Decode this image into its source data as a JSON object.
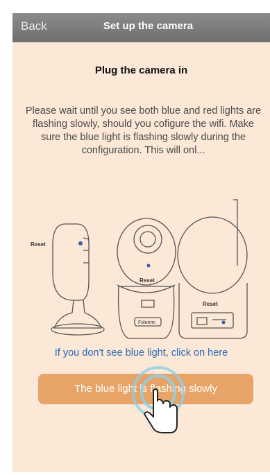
{
  "navbar": {
    "back_label": "Back",
    "title": "Set up the camera"
  },
  "main": {
    "heading": "Plug the camera in",
    "instructions": "Please wait until you see both blue and red lights are flashing slowly, should you cofigure the wifi. Make sure the blue light is flashing slowly during the configuration. This will onl...",
    "diagram_labels": {
      "side_reset": "Reset",
      "front_reset": "Reset",
      "back_reset": "Reset",
      "brand": "Foleemi"
    },
    "help_link": "If you don't see blue light, click on here",
    "confirm_button": "The blue light is flashing slowly"
  },
  "colors": {
    "accent": "#e8a467",
    "background": "#fbe8d6",
    "link": "#2d6ab8",
    "navbar": "#7d7d7d"
  }
}
